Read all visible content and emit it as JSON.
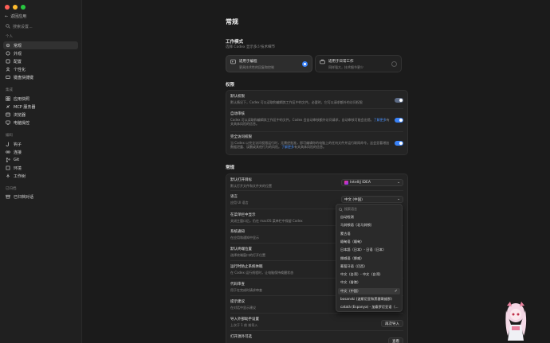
{
  "sidebar": {
    "back": "返回应用",
    "search_placeholder": "搜索设置...",
    "groups": {
      "personal": "个人",
      "integrations": "集成",
      "coding": "编码",
      "archive": "已归档"
    },
    "personal_items": [
      "常规",
      "外观",
      "配置",
      "个性化",
      "键盘快捷键"
    ],
    "integration_items": [
      "应用快照",
      "MCP 服务器",
      "浏览器",
      "电脑操控"
    ],
    "coding_items": [
      "钩子",
      "连接",
      "Git",
      "环境",
      "工作树"
    ],
    "archive_items": [
      "已归档对话"
    ]
  },
  "main": {
    "title": "常规",
    "work_mode": {
      "title": "工作模式",
      "subtitle": "选择 Codex 显示多少技术细节",
      "options": [
        {
          "title": "适用于编程",
          "subtitle": "更具技术性的回复和控制"
        },
        {
          "title": "适用于日常工作",
          "subtitle": "同样强大，技术细节更少"
        }
      ]
    },
    "permissions": {
      "title": "权限",
      "rows": [
        {
          "label": "默认权限",
          "desc": "默认情况下，Codex 可以读取和编辑其工作区中的文件。必要时，它可以请求额外的访问权限"
        },
        {
          "label": "自动审核",
          "desc_pre": "Codex 可以读取和编辑其工作区中的文件。Codex 会自动审核额外访问请求，自动审核可能会出错。",
          "desc_link": "了解更多",
          "desc_post": "有关具体风险的信息。"
        },
        {
          "label": "完全访问权限",
          "desc_pre": "当 Codex 以完全访问权限运行时，无需经批准，即可编辑你的电脑上的任何文件并运行联网命令。这会显著增加数据泄露、误删或其他行为的风险。",
          "desc_link": "了解更多",
          "desc_post": "有关具体风险的信息。"
        }
      ]
    },
    "general": {
      "title": "常规",
      "rows": [
        {
          "label": "默认打开目标",
          "desc": "默认打开文件和文件夹的位置",
          "control": "IntelliJ IDEA"
        },
        {
          "label": "语言",
          "desc": "应用 UI 语言",
          "control": "中文 (中国)"
        },
        {
          "label": "在菜单栏中显示",
          "desc": "关闭主窗口后，仍在 macOS 菜单栏中保留 Codex"
        },
        {
          "label": "系统通知",
          "desc": "在应用和通知中显示"
        },
        {
          "label": "默认终端位置",
          "desc": "选择终端窗口的打开位置"
        },
        {
          "label": "运行时防止系统休眠",
          "desc": "在 Codex 运行线程时，让电脑保持唤醒状态"
        },
        {
          "label": "代码审查",
          "desc": "用于在完成时请求审查"
        },
        {
          "label": "提示建议",
          "desc": "在对话中显示建议"
        },
        {
          "label": "导入外部助手设置",
          "desc": "上次于 1 前 前导入",
          "control": "再次导入"
        },
        {
          "label": "打开源外可选",
          "desc": "",
          "control": "查看"
        }
      ]
    }
  },
  "language_dropdown": {
    "search_placeholder": "搜索语言",
    "items": [
      "自动检测",
      "马其顿语（北马其顿）",
      "蒙古语",
      "缅甸语（缅甸）",
      "日本語（日本）- 日语（日本）",
      "挪威语（挪威）",
      "葡萄牙语（巴西）",
      "中文（台湾）- 中文（台湾）",
      "中文（香港）",
      "中文（中国）",
      "bosanski (波斯尼亚和黑塞哥维那)",
      "català (Espanya) - 加泰罗尼亚语（..."
    ],
    "selected_index": 9
  },
  "colors": {
    "accent": "#3a82f7",
    "background": "#1b1b1b",
    "sidebar": "#202020"
  }
}
